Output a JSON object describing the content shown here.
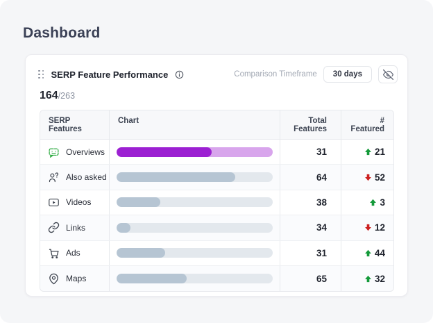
{
  "page": {
    "title": "Dashboard"
  },
  "card": {
    "title": "SERP Feature Performance",
    "info_icon": "info-icon",
    "drag_icon": "drag-handle-icon",
    "comparison_label": "Comparison Timeframe",
    "timeframe_value": "30 days",
    "visibility_icon": "eye-off-icon",
    "count_current": "164",
    "count_total": "/263"
  },
  "table": {
    "headers": [
      "SERP Features",
      "Chart",
      "Total Features",
      "# Featured"
    ],
    "rows": [
      {
        "icon": "ai-overviews-icon",
        "label": "Overviews",
        "bar_pct": 61,
        "bar_fill": "#9c20d2",
        "bar_track": "#d8a5ec",
        "total": "31",
        "trend": "up",
        "change": "21"
      },
      {
        "icon": "people-also-ask-icon",
        "label": "Also asked",
        "bar_pct": 76,
        "bar_fill": "#b6c5d3",
        "bar_track": "#e3e8ed",
        "total": "64",
        "trend": "down",
        "change": "52"
      },
      {
        "icon": "video-icon",
        "label": "Videos",
        "bar_pct": 28,
        "bar_fill": "#b6c5d3",
        "bar_track": "#e3e8ed",
        "total": "38",
        "trend": "up",
        "change": "3"
      },
      {
        "icon": "link-icon",
        "label": "Links",
        "bar_pct": 9,
        "bar_fill": "#b6c5d3",
        "bar_track": "#e3e8ed",
        "total": "34",
        "trend": "down",
        "change": "12"
      },
      {
        "icon": "cart-icon",
        "label": "Ads",
        "bar_pct": 31,
        "bar_fill": "#b6c5d3",
        "bar_track": "#e3e8ed",
        "total": "31",
        "trend": "up",
        "change": "44"
      },
      {
        "icon": "map-pin-icon",
        "label": "Maps",
        "bar_pct": 45,
        "bar_fill": "#b6c5d3",
        "bar_track": "#e3e8ed",
        "total": "65",
        "trend": "up",
        "change": "32"
      }
    ]
  },
  "colors": {
    "trend_up": "#149a3a",
    "trend_down": "#cc2121",
    "accent_purple": "#9c20d2",
    "overviews_icon_green": "#27a83c",
    "page_bg": "#f5f6f8"
  }
}
